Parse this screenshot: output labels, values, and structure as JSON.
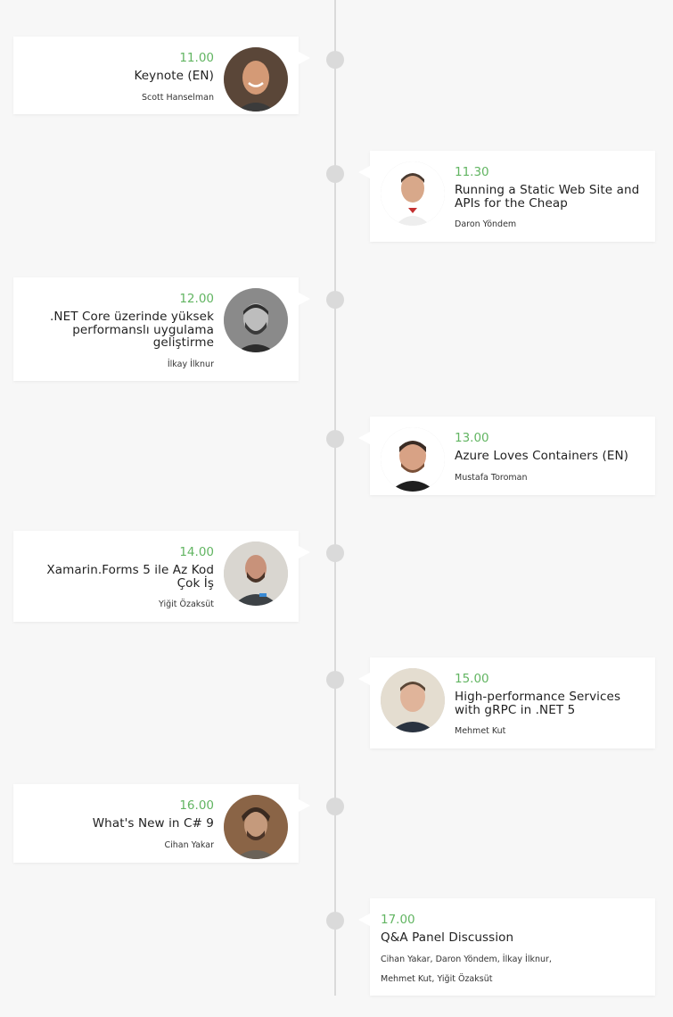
{
  "sessions": [
    {
      "time": "11.00",
      "title": "Keynote (EN)",
      "speaker": "Scott Hanselman",
      "avatar_icon": "speaker-photo-scott-hanselman"
    },
    {
      "time": "11.30",
      "title": "Running a Static Web Site and APIs for the Cheap",
      "speaker": "Daron Yöndem",
      "avatar_icon": "speaker-photo-daron-yondem"
    },
    {
      "time": "12.00",
      "title": ".NET Core üzerinde yüksek performanslı uygulama geliştirme",
      "speaker": "İlkay İlknur",
      "avatar_icon": "speaker-photo-ilkay-ilknur"
    },
    {
      "time": "13.00",
      "title": "Azure Loves Containers (EN)",
      "speaker": "Mustafa Toroman",
      "avatar_icon": "speaker-photo-mustafa-toroman"
    },
    {
      "time": "14.00",
      "title": "Xamarin.Forms 5 ile Az Kod Çok İş",
      "speaker": "Yiğit Özaksüt",
      "avatar_icon": "speaker-photo-yigit-ozaksut"
    },
    {
      "time": "15.00",
      "title": "High-performance Services with gRPC in .NET 5",
      "speaker": "Mehmet Kut",
      "avatar_icon": "speaker-photo-mehmet-kut"
    },
    {
      "time": "16.00",
      "title": "What's New in C# 9",
      "speaker": "Cihan Yakar",
      "avatar_icon": "speaker-photo-cihan-yakar"
    },
    {
      "time": "17.00",
      "title": "Q&A Panel Discussion",
      "speaker_line1": "Cihan Yakar, Daron Yöndem, İlkay İlknur,",
      "speaker_line2": "Mehmet Kut, Yiğit Özaksüt"
    }
  ],
  "colors": {
    "time": "#62b562",
    "line": "#dadada",
    "background": "#f7f7f7"
  }
}
